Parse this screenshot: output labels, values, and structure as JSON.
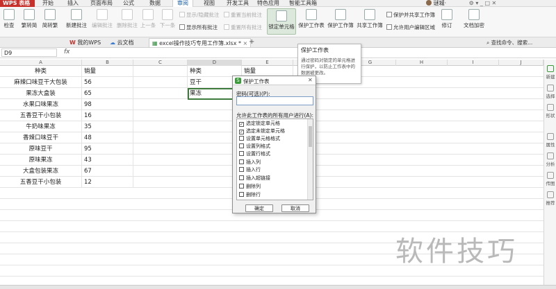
{
  "app": {
    "logo": "WPS 表格",
    "menu_tabs": [
      "开始",
      "插入",
      "页面布局",
      "公式",
      "数据",
      "审阅",
      "视图",
      "开发工具",
      "特色应用",
      "智能工具箱"
    ],
    "active_menu": "审阅",
    "username": "谜城·",
    "accent_color": "#c8302b"
  },
  "ribbon": {
    "spell_check": "检查",
    "trad_chinese": "繁转简",
    "simp_chinese": "简转繁",
    "new_comment": "新建批注",
    "edit_comment": "编辑批注",
    "delete_comment": "删除批注",
    "prev": "上一条",
    "next": "下一条",
    "show_hide_comment": "显示/隐藏批注",
    "reset_current_comment": "重置当前批注",
    "show_all_comments": "显示所有批注",
    "reset_all_comments": "重置所有批注",
    "lock_cell": "锁定单元格",
    "protect_sheet": "保护工作表",
    "protect_workbook": "保护工作簿",
    "share_workbook": "共享工作簿",
    "protect_and_share": "保护并共享工作簿",
    "allow_edit_ranges": "允许用户编辑区域",
    "revisions": "修订",
    "doc_encrypt": "文档加密"
  },
  "doc_tabs": {
    "my_wps": "我的WPS",
    "cloud_docs": "云文档",
    "current_file": "excel操作技巧专用工作簿.xlsx *",
    "search_hint": "查找命令、搜索..."
  },
  "formula_bar": {
    "name_box": "D9",
    "fx": "fx",
    "content": ""
  },
  "columns": [
    "A",
    "B",
    "C",
    "D",
    "E",
    "F",
    "G",
    "H",
    "I",
    "J"
  ],
  "table1": {
    "header": [
      "种类",
      "销量"
    ],
    "rows": [
      [
        "麻辣口味豆干大包装",
        "56"
      ],
      [
        "果冻大盒装",
        "65"
      ],
      [
        "水果口味果冻",
        "98"
      ],
      [
        "五香豆干小包装",
        "16"
      ],
      [
        "牛奶味果冻",
        "35"
      ],
      [
        "香辣口味豆干",
        "48"
      ],
      [
        "原味豆干",
        "95"
      ],
      [
        "原味果冻",
        "43"
      ],
      [
        "大盒包装果冻",
        "67"
      ],
      [
        "五香豆干小包装",
        "12"
      ]
    ]
  },
  "table2": {
    "header": [
      "种类",
      "销量"
    ],
    "rows": [
      [
        "豆干",
        ""
      ],
      [
        "果冻",
        ""
      ]
    ]
  },
  "tooltip": {
    "title": "保护工作表",
    "body": "通过密码对锁定的单元格进行保护，以防止工作表中的数据被更改。"
  },
  "dialog": {
    "title": "保护工作表",
    "password_label": "密码(可选)(P):",
    "password_value": "",
    "allow_label": "允许此工作表的所有用户进行(A):",
    "permissions": [
      {
        "label": "选定锁定单元格",
        "checked": true
      },
      {
        "label": "选定未锁定单元格",
        "checked": true
      },
      {
        "label": "设置单元格格式",
        "checked": false
      },
      {
        "label": "设置列格式",
        "checked": false
      },
      {
        "label": "设置行格式",
        "checked": false
      },
      {
        "label": "插入列",
        "checked": false
      },
      {
        "label": "插入行",
        "checked": false
      },
      {
        "label": "插入超链接",
        "checked": false
      },
      {
        "label": "删除列",
        "checked": false
      },
      {
        "label": "删除行",
        "checked": false
      }
    ],
    "ok": "确定",
    "cancel": "取消"
  },
  "sidebar": [
    "新建",
    "选择",
    "形状",
    "属性",
    "分析",
    "传图",
    "推荐"
  ],
  "watermark": "软件技巧"
}
